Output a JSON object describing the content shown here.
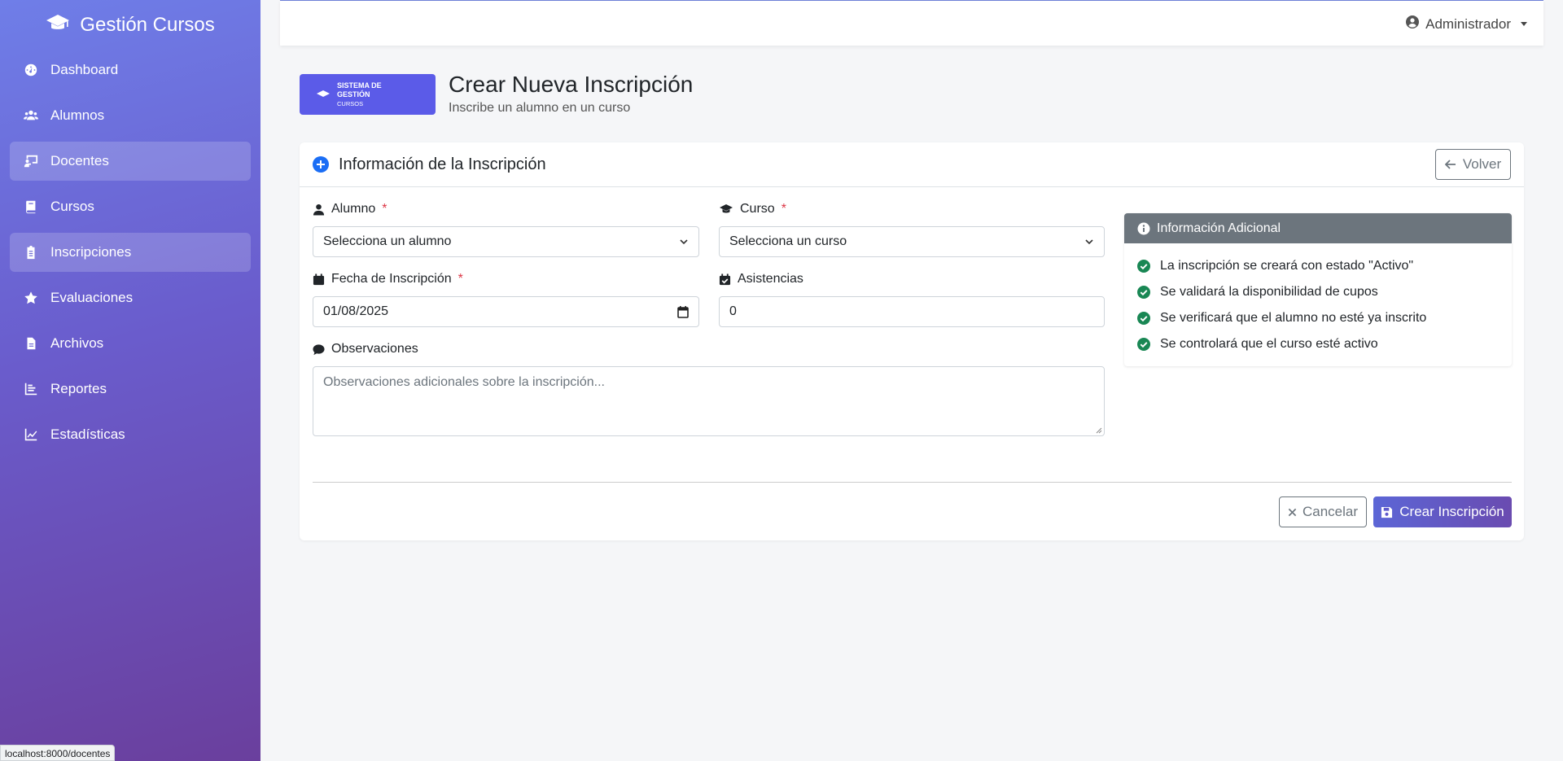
{
  "sidebar": {
    "brand": "Gestión Cursos",
    "brand_icon": "graduation-cap-icon",
    "items": [
      {
        "label": "Dashboard",
        "icon": "gauge-icon"
      },
      {
        "label": "Alumnos",
        "icon": "users-icon"
      },
      {
        "label": "Docentes",
        "icon": "chalkboard-teacher-icon"
      },
      {
        "label": "Cursos",
        "icon": "book-icon"
      },
      {
        "label": "Inscripciones",
        "icon": "clipboard-icon"
      },
      {
        "label": "Evaluaciones",
        "icon": "star-icon"
      },
      {
        "label": "Archivos",
        "icon": "file-icon"
      },
      {
        "label": "Reportes",
        "icon": "chart-bar-icon"
      },
      {
        "label": "Estadísticas",
        "icon": "chart-line-icon"
      }
    ],
    "active": "Inscripciones",
    "hovered": "Docentes"
  },
  "statusbar": {
    "url": "localhost:8000/docentes"
  },
  "topbar": {
    "user": "Administrador"
  },
  "header": {
    "logo_line1": "SISTEMA DE",
    "logo_line2": "GESTIÓN",
    "logo_line3": "CURSOS",
    "title": "Crear Nueva Inscripción",
    "subtitle": "Inscribe un alumno en un curso"
  },
  "card": {
    "title": "Información de la Inscripción",
    "back_label": "Volver"
  },
  "form": {
    "alumno_label": "Alumno",
    "alumno_value": "Selecciona un alumno",
    "curso_label": "Curso",
    "curso_value": "Selecciona un curso",
    "fecha_label": "Fecha de Inscripción",
    "fecha_value": "01/08/2025",
    "asistencias_label": "Asistencias",
    "asistencias_value": "0",
    "observaciones_label": "Observaciones",
    "observaciones_placeholder": "Observaciones adicionales sobre la inscripción...",
    "required_mark": "*"
  },
  "info": {
    "title": "Información Adicional",
    "items": [
      "La inscripción se creará con estado \"Activo\"",
      "Se validará la disponibilidad de cupos",
      "Se verificará que el alumno no esté ya inscrito",
      "Se controlará que el curso esté activo"
    ]
  },
  "actions": {
    "cancel": "Cancelar",
    "submit": "Crear Inscripción"
  },
  "colors": {
    "accent": "#5b5be8",
    "primary_blue": "#1b6ef5",
    "success": "#198754",
    "required": "#dc3545"
  }
}
